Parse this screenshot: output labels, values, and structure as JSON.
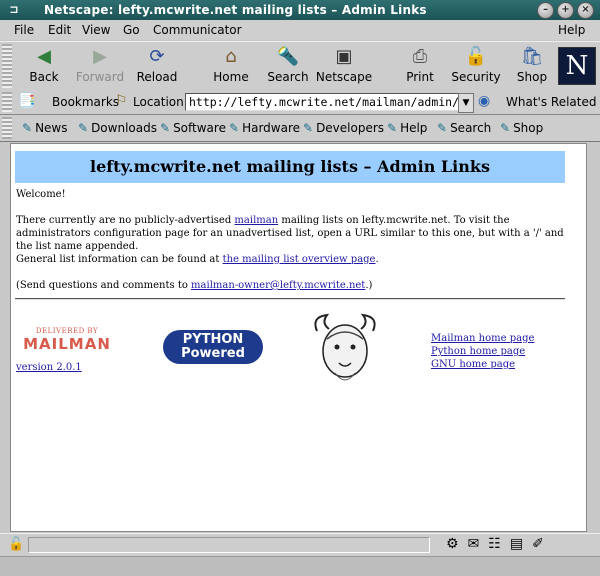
{
  "window": {
    "title": "Netscape: lefty.mcwrite.net mailing lists – Admin Links"
  },
  "menubar": {
    "file": "File",
    "edit": "Edit",
    "view": "View",
    "go": "Go",
    "communicator": "Communicator",
    "help": "Help"
  },
  "navbar": {
    "back": "Back",
    "forward": "Forward",
    "reload": "Reload",
    "home": "Home",
    "search": "Search",
    "netscape": "Netscape",
    "print": "Print",
    "security": "Security",
    "shop": "Shop"
  },
  "location": {
    "bookmarks": "Bookmarks",
    "label": "Location:",
    "url": "http://lefty.mcwrite.net/mailman/admin/",
    "whats_related": "What's Related"
  },
  "personal": {
    "news": "News",
    "downloads": "Downloads",
    "software": "Software",
    "hardware": "Hardware",
    "developers": "Developers",
    "help": "Help",
    "search": "Search",
    "shop": "Shop"
  },
  "page": {
    "heading": "lefty.mcwrite.net mailing lists – Admin Links",
    "welcome": "Welcome!",
    "p1_a": "There currently are no publicly-advertised ",
    "p1_link": "mailman",
    "p1_b": " mailing lists on lefty.mcwrite.net. To visit the administrators configuration page for an unadvertised list, open a URL similar to this one, but with a '/' and the list name appended.",
    "p2_a": "General list information can be found at ",
    "p2_link": "the mailing list overview page",
    "p2_b": ".",
    "p3_a": "(Send questions and comments to ",
    "p3_link": "mailman-owner@lefty.mcwrite.net",
    "p3_b": ".)",
    "mailman_logo_small": "DELIVERED BY",
    "mailman_logo_big": "MAILMAN",
    "version": "version 2.0.1",
    "python_l1": "PYTHON",
    "python_l2": "Powered",
    "link_mailman": "Mailman home page",
    "link_python": "Python home page",
    "link_gnu": "GNU home page"
  }
}
